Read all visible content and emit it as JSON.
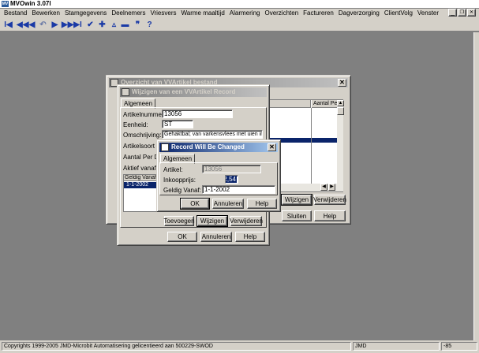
{
  "app": {
    "title": "MVOwin 3.07l",
    "menu": [
      "Bestand",
      "Bewerken",
      "Stamgegevens",
      "Deelnemers",
      "Vriesvers",
      "Warme maaltijd",
      "Alarmering",
      "Overzichten",
      "Factureren",
      "Dagverzorging",
      "ClientVolg",
      "Venster"
    ],
    "controls": {
      "minimize": "_",
      "restore": "❐",
      "close": "✕"
    }
  },
  "toolbar": {
    "icons": [
      "first-record",
      "previous-page",
      "previous-record",
      "refresh",
      "next-record",
      "next-page",
      "last-record",
      "confirm-check",
      "add-plus",
      "up-triangle",
      "delete-minus",
      "quote",
      "help-question"
    ],
    "glyphs": [
      "I◀",
      "◀◀",
      "◀",
      "↶",
      "▶",
      "▶▶",
      "▶I",
      "✔",
      "✚",
      "▵",
      "▬",
      "❞",
      "?"
    ]
  },
  "overview_window": {
    "title": "Overzicht van VVArtikel bestand",
    "column_header": "Aantal Pe",
    "buttons": {
      "wijzigen": "Wijzigen",
      "verwijderen": "Verwijderen",
      "sluiten": "Sluiten",
      "help": "Help"
    }
  },
  "edit_window": {
    "title": "Wijzigen van een VVArtikel Record",
    "tab": "Algemeen",
    "labels": {
      "artikelnummer": "Artikelnummer:",
      "eenheid": "Eenheid:",
      "omschrijving": "Omschrijving:",
      "artikelsoort": "Artikelsoort",
      "aantal_per_doos": "Aantal Per Doo",
      "aktief_vanaf": "Aktief vanaf:"
    },
    "values": {
      "artikelnummer": "13056",
      "eenheid": "ST",
      "omschrijving": "Gehaktbal; van varkensvlees met uien in jus"
    },
    "list": {
      "header": "Geldig Vanaf",
      "items": [
        "1-1-2002"
      ]
    },
    "buttons": {
      "toevoegen": "Toevoegen",
      "wijzigen": "Wijzigen",
      "verwijderen": "Verwijderen",
      "ok": "OK",
      "annuleren": "Annuleren",
      "help": "Help"
    }
  },
  "record_dialog": {
    "title": "Record Will Be Changed",
    "tab": "Algemeen",
    "labels": {
      "artikel": "Artikel:",
      "inkoopprijs": "Inkoopprijs:",
      "geldig_vanaf": "Geldig Vanaf:"
    },
    "values": {
      "artikel": "13056",
      "inkoopprijs": "2,54",
      "geldig_vanaf": "1-1-2002"
    },
    "buttons": {
      "ok": "OK",
      "annuleren": "Annuleren",
      "help": "Help"
    }
  },
  "statusbar": {
    "copyright": "Copyrights 1999-2005 JMD-Microbit Automatisering gelicentieerd aan 500229-SWOD",
    "user": "JMD",
    "code": "-85"
  },
  "colors": {
    "desktop": "#808080",
    "face": "#d4d0c8",
    "title_active": "#0a246a",
    "selection": "#0a246a"
  }
}
